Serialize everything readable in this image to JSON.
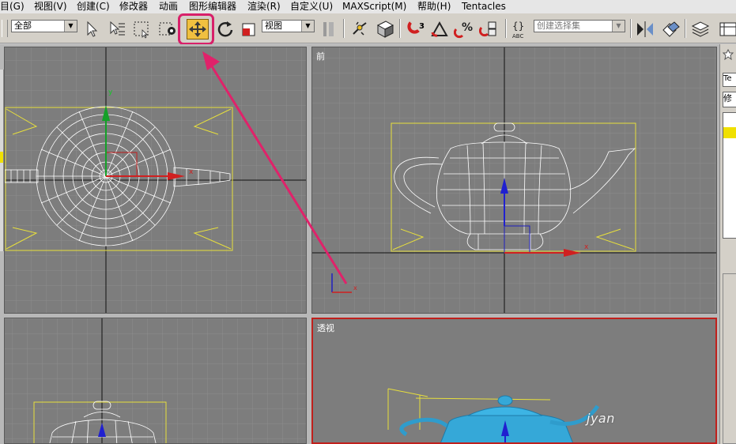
{
  "menubar": {
    "items": [
      {
        "label": "目(G)"
      },
      {
        "label": "视图(V)"
      },
      {
        "label": "创建(C)"
      },
      {
        "label": "修改器"
      },
      {
        "label": "动画"
      },
      {
        "label": "图形编辑器"
      },
      {
        "label": "渲染(R)"
      },
      {
        "label": "自定义(U)"
      },
      {
        "label": "MAXScript(M)"
      },
      {
        "label": "帮助(H)"
      },
      {
        "label": "Tentacles"
      }
    ]
  },
  "toolbar": {
    "selection_filter": "全部",
    "reference_coord": "视图",
    "named_selection_placeholder": "创建选择集",
    "highlighted_tool": "move-icon",
    "icons": [
      "select-arrow-icon",
      "select-by-name-icon",
      "rect-region-icon",
      "window-crossing-icon",
      "move-icon",
      "rotate-icon",
      "scale-icon",
      "pivot-icon",
      "link-icon",
      "cube-icon",
      "snap-3-icon",
      "angle-snap-icon",
      "percent-snap-icon",
      "spinner-snap-icon",
      "named-selection-icon",
      "mirror-icon",
      "align-icon",
      "layers-icon",
      "curve-editor-icon"
    ],
    "snap_label": "3",
    "abc_label": "ABC"
  },
  "viewports": {
    "top": {
      "label": ""
    },
    "front": {
      "label": "前"
    },
    "left": {
      "label": ""
    },
    "perspective": {
      "label": "透视"
    }
  },
  "gizmo": {
    "x_label": "x",
    "y_label": "y"
  },
  "command_panel": {
    "text1": "Te",
    "text2": "修"
  },
  "watermark": "jyan",
  "colors": {
    "highlight_border": "#d8206a",
    "arrow": "#e0226a",
    "bbox": "#e8e03c",
    "active_viewport": "#c0201c",
    "viewport_bg": "#7d7d7d",
    "teapot_wire": "#ffffff",
    "teapot_shaded": "#35a8d8"
  }
}
